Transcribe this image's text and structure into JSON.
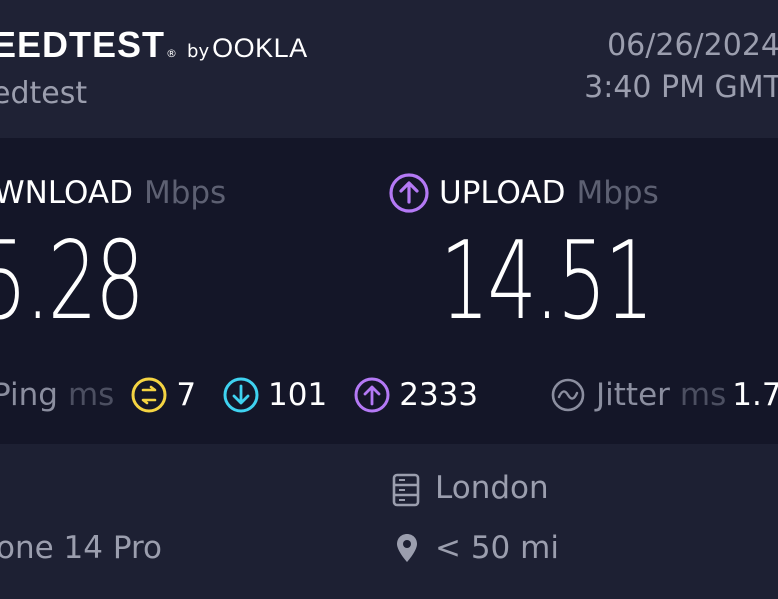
{
  "header": {
    "brand_name": "EEDTEST",
    "brand_tm": "®",
    "brand_by": "by",
    "brand_ookla": "OOKLA",
    "subtitle": "edtest",
    "date": "06/26/2024",
    "time": "3:40 PM GMT"
  },
  "download": {
    "label": "WNLOAD",
    "unit": "Mbps",
    "value": "5.28",
    "icon": "download-circle-icon"
  },
  "upload": {
    "label": "UPLOAD",
    "unit": "Mbps",
    "value": "14.51",
    "icon": "upload-circle-icon",
    "color": "#b479f5"
  },
  "ping": {
    "label": "Ping",
    "unit": "ms",
    "idle": "7",
    "idle_color": "#f5d442",
    "download": "101",
    "download_color": "#3fd2f0",
    "upload": "2333",
    "upload_color": "#b479f5"
  },
  "jitter": {
    "label": "Jitter",
    "unit": "ms",
    "value": "1.7"
  },
  "footer": {
    "device": "one 14 Pro",
    "server": "London",
    "distance": "< 50 mi"
  }
}
